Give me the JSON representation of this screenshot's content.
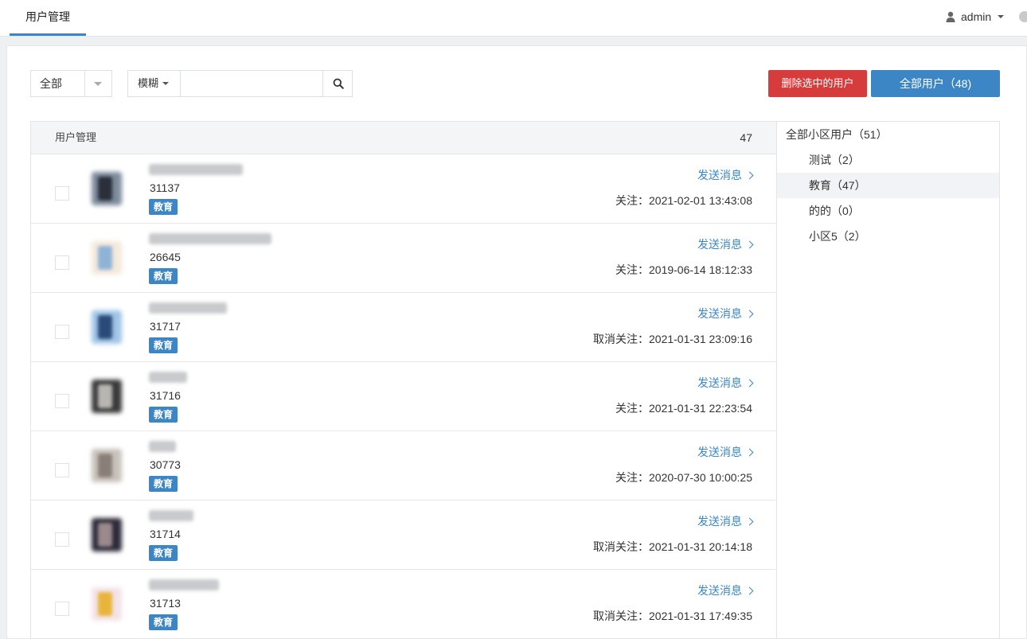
{
  "topbar": {
    "tab_label": "用户管理",
    "user_label": "admin"
  },
  "toolbar": {
    "scope_selected": "全部",
    "match_mode": "模糊",
    "search_value": "",
    "delete_label": "删除选中的用户",
    "all_users_label": "全部用户（48)"
  },
  "list": {
    "header_title": "用户管理",
    "header_count": "47",
    "send_label": "发送消息",
    "rows": [
      {
        "uid": "31137",
        "tag": "教育",
        "follow": "关注：2021-02-01 13:43:08",
        "avatar_colors": [
          "#7d8b9c",
          "#2a2f3a"
        ]
      },
      {
        "uid": "26645",
        "tag": "教育",
        "follow": "关注：2019-06-14 18:12:33",
        "avatar_colors": [
          "#f4e9dc",
          "#8fb3d6"
        ]
      },
      {
        "uid": "31717",
        "tag": "教育",
        "follow": "取消关注：2021-01-31 23:09:16",
        "avatar_colors": [
          "#9fc4e6",
          "#2a4a7a"
        ]
      },
      {
        "uid": "31716",
        "tag": "教育",
        "follow": "关注：2021-01-31 22:23:54",
        "avatar_colors": [
          "#3a3a3a",
          "#b8b6b0"
        ]
      },
      {
        "uid": "30773",
        "tag": "教育",
        "follow": "关注：2020-07-30 10:00:25",
        "avatar_colors": [
          "#c9c2bc",
          "#8a7f78"
        ]
      },
      {
        "uid": "31714",
        "tag": "教育",
        "follow": "取消关注：2021-01-31 20:14:18",
        "avatar_colors": [
          "#2e2c3a",
          "#9a8a8c"
        ]
      },
      {
        "uid": "31713",
        "tag": "教育",
        "follow": "取消关注：2021-01-31 17:49:35",
        "avatar_colors": [
          "#f3e3e8",
          "#e9b43c"
        ]
      }
    ]
  },
  "groups": {
    "root": "全部小区用户（51）",
    "items": [
      {
        "label": "测试（2）",
        "active": false
      },
      {
        "label": "教育（47）",
        "active": true
      },
      {
        "label": "的的（0）",
        "active": false
      },
      {
        "label": "小区5（2）",
        "active": false
      }
    ]
  },
  "colors": {
    "accent": "#3d86c6",
    "danger": "#d63c3c"
  }
}
